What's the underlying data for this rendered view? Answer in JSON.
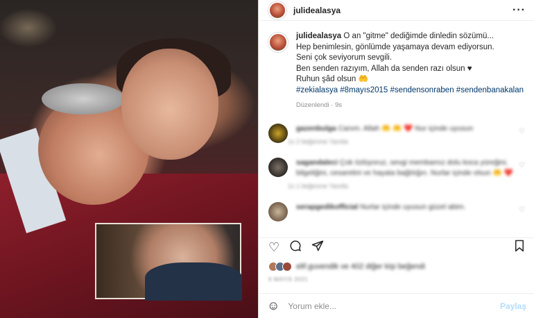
{
  "post": {
    "image_alt": "photo"
  },
  "header": {
    "username": "julidealasya",
    "more_icon": "more-horizontal-icon"
  },
  "caption": {
    "username": "julidealasya",
    "line1": "O an \"gitme\" dediğimde dinledin sözümü...",
    "line2": "Hep benimlesin, gönlümde yaşamaya devam ediyorsun.",
    "line3": "Seni çok seviyorum sevgili.",
    "line4": "Ben senden razıyım, Allah da senden razı olsun ♥",
    "line5": "Ruhun şâd olsun 🤲",
    "hashtags": "#zekialasya #8mayıs2015 #sendensonraben #sendenbanakalan",
    "edited": "Düzenlendi · 9s"
  },
  "comments": [
    {
      "username": "gazenbulga",
      "text": "Canım. Allah 🤲 🤲 ❤️ Nur içinde uyusun",
      "meta": "1s   2 beğenme   Yanıtla"
    },
    {
      "username": "sagandaleci",
      "text": "Çok özlüyoruz, sevgi membamız dolu koca yüreğini, bilgeliğini, cesaretini ve hayata bağlılığın. Nurlar içinde olsun 🤲 ❤️",
      "meta": "1s   1 beğenme   Yanıtla"
    },
    {
      "username": "serapgedikofficial",
      "text": "Nurlar içinde uyusun güzel abim.",
      "meta": ""
    }
  ],
  "likes": {
    "text": "elif.guvendik ve 402 diğer kişi beğendi"
  },
  "date": "9 MAYIS 2021",
  "add_comment": {
    "placeholder": "Yorum ekle...",
    "post_label": "Paylaş"
  }
}
